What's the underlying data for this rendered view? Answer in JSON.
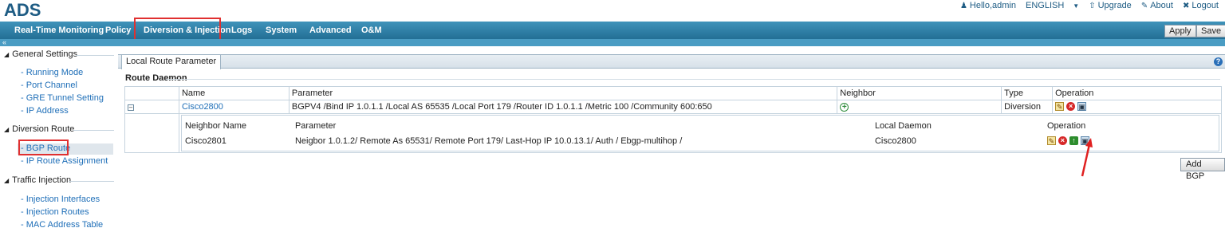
{
  "app": {
    "logo": "ADS"
  },
  "top_links": {
    "greeting": "Hello,admin",
    "language": "ENGLISH",
    "upgrade": "Upgrade",
    "about": "About",
    "logout": "Logout"
  },
  "nav": {
    "items": [
      "Real-Time Monitoring",
      "Policy",
      "Diversion & Injection",
      "Logs",
      "System",
      "Advanced",
      "O&M"
    ],
    "apply": "Apply",
    "save": "Save"
  },
  "sidebar": {
    "general_settings": "General Settings",
    "general_items": [
      "Running Mode",
      "Port Channel",
      "GRE Tunnel Setting",
      "IP Address"
    ],
    "diversion_route": "Diversion Route",
    "diversion_items": [
      "BGP Route",
      "IP Route Assignment"
    ],
    "traffic_injection": "Traffic Injection",
    "injection_items": [
      "Injection Interfaces",
      "Injection Routes",
      "MAC Address Table"
    ]
  },
  "content": {
    "tab": "Local Route Parameter",
    "section_title": "Route Daemon",
    "table_headers": [
      "Name",
      "Parameter",
      "Neighbor",
      "Type",
      "Operation"
    ],
    "row": {
      "name": "Cisco2800",
      "parameter": "BGPV4 /Bind IP 1.0.1.1 /Local AS 65535 /Local Port 179 /Router ID 1.0.1.1 /Metric 100 /Community 600:650",
      "type": "Diversion"
    },
    "neighbor_headers": [
      "Neighbor Name",
      "Parameter",
      "Local Daemon",
      "Operation"
    ],
    "neighbor_row": {
      "name": "Cisco2801",
      "parameter": "Neigbor 1.0.1.2/ Remote As 65531/ Remote Port 179/ Last-Hop IP 10.0.13.1/ Auth / Ebgp-multihop /",
      "local_daemon": "Cisco2800"
    },
    "add_bgp": "Add BGP"
  },
  "colors": {
    "nav_bg": "#2b7fa5",
    "highlight_box": "#e03030",
    "link": "#1f6fb8"
  }
}
